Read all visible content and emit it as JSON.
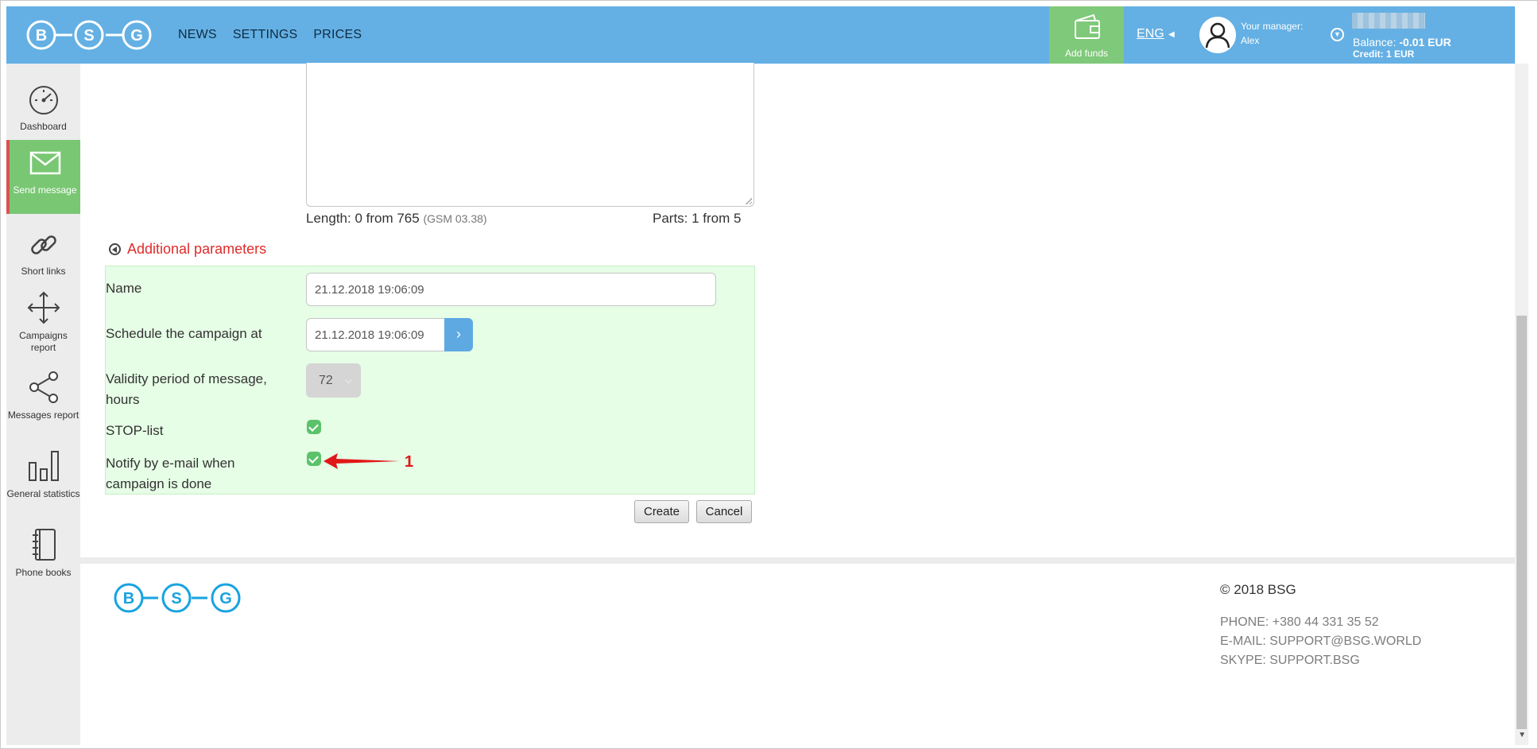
{
  "header": {
    "logo_letters": [
      "B",
      "S",
      "G"
    ],
    "nav": [
      "NEWS",
      "SETTINGS",
      "PRICES"
    ],
    "add_funds": "Add funds",
    "language": "ENG",
    "manager_label": "Your manager:",
    "manager_name": "Alex",
    "balance_label": "Balance:",
    "balance_value": "-0.01 EUR",
    "credit": "Credit: 1 EUR",
    "bar_color": "#64b0e4",
    "add_funds_color": "#7fc97a"
  },
  "sidebar": {
    "items": [
      {
        "label": "Dashboard",
        "icon": "gauge-icon"
      },
      {
        "label": "Send message",
        "icon": "envelope-icon",
        "active": true
      },
      {
        "label": "Short links",
        "icon": "link-icon"
      },
      {
        "label": "Campaigns report",
        "icon": "move-arrows-icon"
      },
      {
        "label": "Messages report",
        "icon": "share-icon"
      },
      {
        "label": "General statistics",
        "icon": "bar-chart-icon"
      },
      {
        "label": "Phone books",
        "icon": "notebook-icon"
      }
    ]
  },
  "message": {
    "length_text": "Length: 0 from 765",
    "encoding": "(GSM 03.38)",
    "parts_text": "Parts: 1 from 5"
  },
  "additional": {
    "toggle_label": "Additional parameters",
    "name_label": "Name",
    "name_value": "21.12.2018 19:06:09",
    "schedule_label": "Schedule the campaign at",
    "schedule_value": "21.12.2018 19:06:09",
    "validity_label": "Validity period of message, hours",
    "validity_value": "72",
    "stoplist_label": "STOP-list",
    "stoplist_checked": true,
    "notify_label": "Notify by e-mail when campaign is done",
    "notify_checked": true,
    "panel_color": "#e6fde6"
  },
  "actions": {
    "create": "Create",
    "cancel": "Cancel"
  },
  "annotation": {
    "number": "1",
    "color": "#e01717"
  },
  "footer": {
    "copyright": "© 2018 BSG",
    "phone": "PHONE: +380 44 331 35 52",
    "email": "E-MAIL: SUPPORT@BSG.WORLD",
    "skype": "SKYPE: SUPPORT.BSG"
  }
}
